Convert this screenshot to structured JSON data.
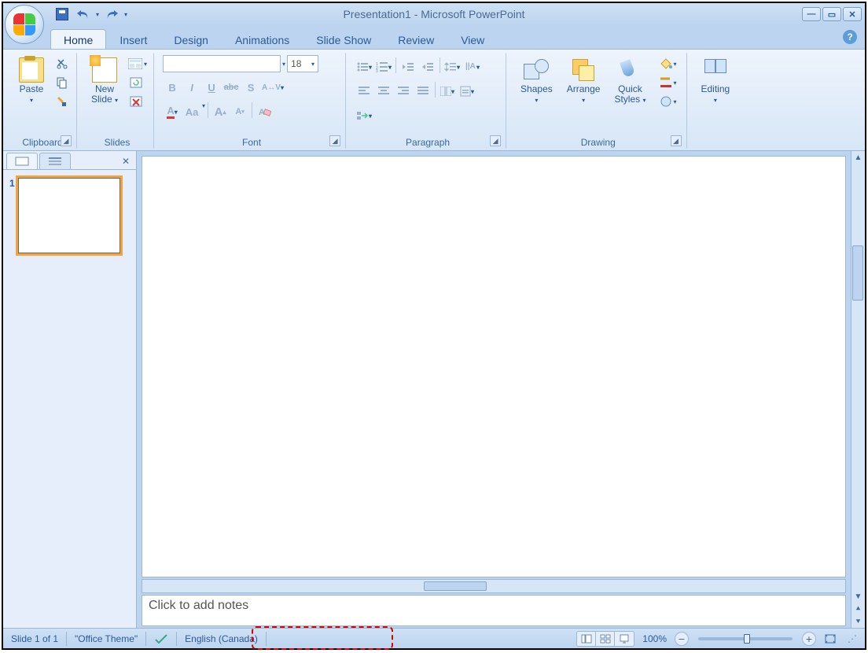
{
  "title": "Presentation1 - Microsoft PowerPoint",
  "qat": {
    "save": "Save",
    "undo": "Undo",
    "redo": "Redo"
  },
  "tabs": [
    "Home",
    "Insert",
    "Design",
    "Animations",
    "Slide Show",
    "Review",
    "View"
  ],
  "active_tab": "Home",
  "ribbon": {
    "clipboard": {
      "label": "Clipboard",
      "paste": "Paste",
      "cut": "Cut",
      "copy": "Copy",
      "painter": "Format Painter"
    },
    "slides": {
      "label": "Slides",
      "new_slide": "New\nSlide",
      "layout": "Layout",
      "reset": "Reset",
      "delete": "Delete"
    },
    "font": {
      "label": "Font",
      "name_value": "",
      "size_value": "18",
      "bold": "B",
      "italic": "I",
      "underline": "U",
      "strike": "abc",
      "shadow": "S",
      "spacing": "AV",
      "color": "A",
      "case": "Aa",
      "grow": "A",
      "shrink": "A",
      "clear": "Clear"
    },
    "paragraph": {
      "label": "Paragraph"
    },
    "drawing": {
      "label": "Drawing",
      "shapes": "Shapes",
      "arrange": "Arrange",
      "qstyles": "Quick\nStyles",
      "fill": "Shape Fill",
      "outline": "Shape Outline",
      "effects": "Shape Effects"
    },
    "editing": {
      "label": "Editing"
    }
  },
  "thumbnails": {
    "slide_number": "1"
  },
  "notes_placeholder": "Click to add notes",
  "status": {
    "slide_count": "Slide 1 of 1",
    "theme": "\"Office Theme\"",
    "language": "English (Canada)",
    "zoom": "100%"
  }
}
